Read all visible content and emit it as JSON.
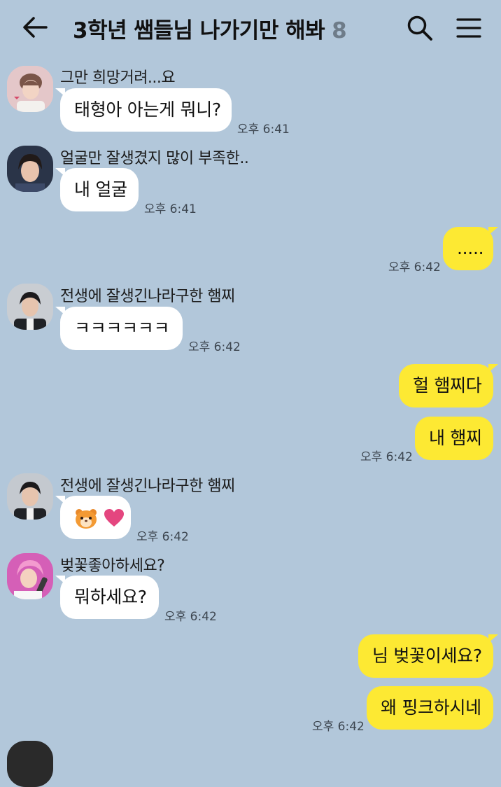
{
  "header": {
    "title": "3학년 쌤들님 나가기만 해봐",
    "member_count": "8",
    "icons": [
      "back-arrow-icon",
      "search-icon",
      "menu-icon"
    ]
  },
  "messages": [
    {
      "sender": "그만 희망거려...요",
      "text": "태형아 아는게 뭐니?",
      "time": "오후 6:41",
      "direction": "incoming"
    },
    {
      "sender": "얼굴만 잘생겼지 많이 부족한..",
      "text": "내 얼굴",
      "time": "오후 6:41",
      "direction": "incoming"
    },
    {
      "text": ".....",
      "time": "오후 6:42",
      "direction": "outgoing"
    },
    {
      "sender": "전생에 잘생긴나라구한 햄찌",
      "text": "ㅋㅋㅋㅋㅋㅋ",
      "time": "오후 6:42",
      "direction": "incoming"
    },
    {
      "text": "헐 햄찌다",
      "direction": "outgoing"
    },
    {
      "text": "내 햄찌",
      "time": "오후 6:42",
      "direction": "outgoing"
    },
    {
      "sender": "전생에 잘생긴나라구한 햄찌",
      "emoji": [
        "hamster-emoji",
        "heart-emoji"
      ],
      "time": "오후 6:42",
      "direction": "incoming"
    },
    {
      "sender": "벚꽃좋아하세요?",
      "text": "뭐하세요?",
      "time": "오후 6:42",
      "direction": "incoming"
    },
    {
      "text": "님 벚꽃이세요?",
      "direction": "outgoing"
    },
    {
      "text": "왜 핑크하시네",
      "time": "오후 6:42",
      "direction": "outgoing"
    }
  ],
  "colors": {
    "background": "#b2c7da",
    "incoming_bubble": "#ffffff",
    "outgoing_bubble": "#fde933",
    "count": "#6e7c89"
  }
}
